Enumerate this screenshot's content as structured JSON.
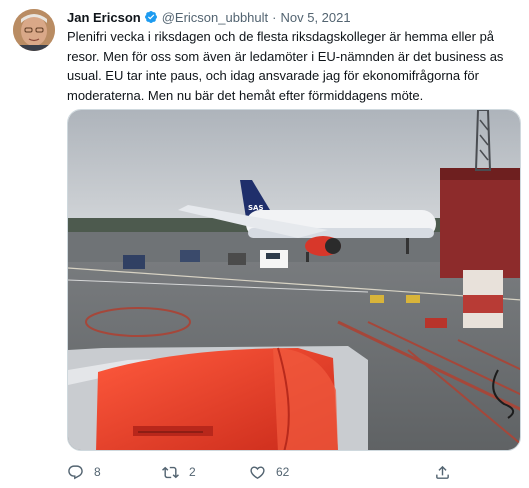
{
  "tweet": {
    "author_name": "Jan Ericson",
    "handle": "@Ericson_ubbhult",
    "separator": "·",
    "date": "Nov 5, 2021",
    "text": "Plenifri vecka i riksdagen och de flesta riksdagskolleger är hemma eller på resor. Men för oss som även är ledamöter i EU-nämnden är det business as usual. EU tar inte paus, och idag ansvarade jag för ekonomifrågorna för moderaterna. Men nu bär det hemåt efter förmiddagens möte.",
    "airplane_tail_text": "SAS"
  },
  "actions": {
    "reply_count": "8",
    "retweet_count": "2",
    "like_count": "62"
  },
  "colors": {
    "verified": "#1d9bf0",
    "muted_text": "#536471",
    "engine_red": "#e23b2a"
  },
  "icons": [
    "verified-badge-icon",
    "reply-icon",
    "retweet-icon",
    "like-icon",
    "share-icon"
  ]
}
